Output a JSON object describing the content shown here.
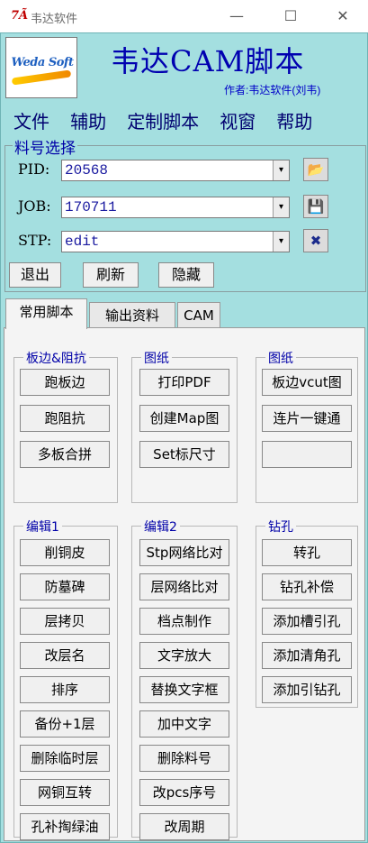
{
  "window": {
    "app_icon": "7Ã",
    "title": "韦达软件",
    "controls": {
      "minimize": "—",
      "maximize": "☐",
      "close": "✕"
    }
  },
  "header": {
    "logo_text": "Weda Soft",
    "title": "韦达CAM脚本",
    "author": "作者:韦达软件(刘韦)"
  },
  "menu": [
    "文件",
    "辅助",
    "定制脚本",
    "视窗",
    "帮助"
  ],
  "material": {
    "legend": "料号选择",
    "fields": [
      {
        "label": "PID:",
        "value": "20568"
      },
      {
        "label": "JOB:",
        "value": "170711"
      },
      {
        "label": "STP:",
        "value": "edit"
      }
    ],
    "combo_arrow": "▾",
    "icons": {
      "open": "📂",
      "save": "💾",
      "close": "✖"
    },
    "buttons": {
      "exit": "退出",
      "refresh": "刷新",
      "hide": "隐藏"
    }
  },
  "tabs": [
    "常用脚本",
    "输出资料",
    "CAM"
  ],
  "sections": {
    "board_impedance": {
      "legend": "板边&阻抗",
      "buttons": [
        "跑板边",
        "跑阻抗",
        "多板合拼"
      ]
    },
    "drawing1": {
      "legend": "图纸",
      "buttons": [
        "打印PDF",
        "创建Map图",
        "Set标尺寸"
      ]
    },
    "drawing2": {
      "legend": "图纸",
      "buttons": [
        "板边vcut图",
        "连片一键通",
        ""
      ]
    },
    "edit1": {
      "legend": "编辑1",
      "buttons": [
        "削铜皮",
        "防墓碑",
        "层拷贝",
        "改层名",
        "排序",
        "备份+1层",
        "删除临时层",
        "网铜互转",
        "孔补掏绿油"
      ]
    },
    "edit2": {
      "legend": "编辑2",
      "buttons": [
        "Stp网络比对",
        "层网络比对",
        "档点制作",
        "文字放大",
        "替换文字框",
        "加中文字",
        "删除料号",
        "改pcs序号",
        "改周期"
      ]
    },
    "drill": {
      "legend": "钻孔",
      "buttons": [
        "转孔",
        "钻孔补偿",
        "添加槽引孔",
        "添加清角孔",
        "添加引钻孔"
      ]
    }
  }
}
